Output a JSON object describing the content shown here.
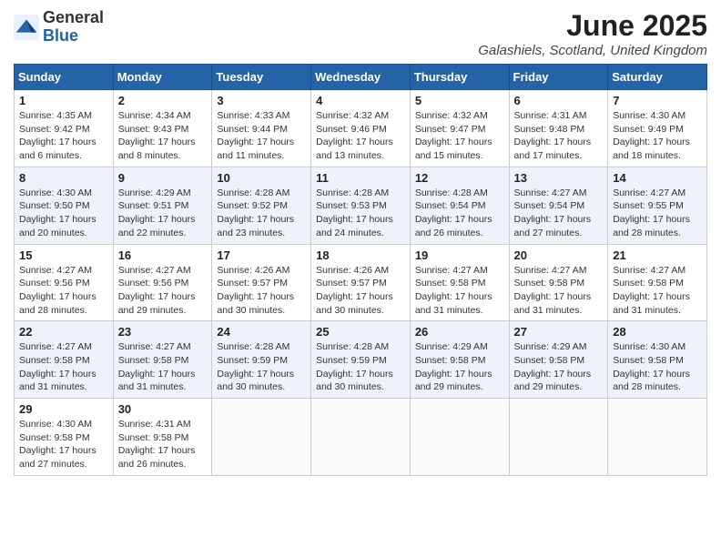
{
  "header": {
    "logo_general": "General",
    "logo_blue": "Blue",
    "month_title": "June 2025",
    "location": "Galashiels, Scotland, United Kingdom"
  },
  "days_of_week": [
    "Sunday",
    "Monday",
    "Tuesday",
    "Wednesday",
    "Thursday",
    "Friday",
    "Saturday"
  ],
  "weeks": [
    [
      {
        "day": "1",
        "sunrise": "4:35 AM",
        "sunset": "9:42 PM",
        "daylight": "17 hours and 6 minutes."
      },
      {
        "day": "2",
        "sunrise": "4:34 AM",
        "sunset": "9:43 PM",
        "daylight": "17 hours and 8 minutes."
      },
      {
        "day": "3",
        "sunrise": "4:33 AM",
        "sunset": "9:44 PM",
        "daylight": "17 hours and 11 minutes."
      },
      {
        "day": "4",
        "sunrise": "4:32 AM",
        "sunset": "9:46 PM",
        "daylight": "17 hours and 13 minutes."
      },
      {
        "day": "5",
        "sunrise": "4:32 AM",
        "sunset": "9:47 PM",
        "daylight": "17 hours and 15 minutes."
      },
      {
        "day": "6",
        "sunrise": "4:31 AM",
        "sunset": "9:48 PM",
        "daylight": "17 hours and 17 minutes."
      },
      {
        "day": "7",
        "sunrise": "4:30 AM",
        "sunset": "9:49 PM",
        "daylight": "17 hours and 18 minutes."
      }
    ],
    [
      {
        "day": "8",
        "sunrise": "4:30 AM",
        "sunset": "9:50 PM",
        "daylight": "17 hours and 20 minutes."
      },
      {
        "day": "9",
        "sunrise": "4:29 AM",
        "sunset": "9:51 PM",
        "daylight": "17 hours and 22 minutes."
      },
      {
        "day": "10",
        "sunrise": "4:28 AM",
        "sunset": "9:52 PM",
        "daylight": "17 hours and 23 minutes."
      },
      {
        "day": "11",
        "sunrise": "4:28 AM",
        "sunset": "9:53 PM",
        "daylight": "17 hours and 24 minutes."
      },
      {
        "day": "12",
        "sunrise": "4:28 AM",
        "sunset": "9:54 PM",
        "daylight": "17 hours and 26 minutes."
      },
      {
        "day": "13",
        "sunrise": "4:27 AM",
        "sunset": "9:54 PM",
        "daylight": "17 hours and 27 minutes."
      },
      {
        "day": "14",
        "sunrise": "4:27 AM",
        "sunset": "9:55 PM",
        "daylight": "17 hours and 28 minutes."
      }
    ],
    [
      {
        "day": "15",
        "sunrise": "4:27 AM",
        "sunset": "9:56 PM",
        "daylight": "17 hours and 28 minutes."
      },
      {
        "day": "16",
        "sunrise": "4:27 AM",
        "sunset": "9:56 PM",
        "daylight": "17 hours and 29 minutes."
      },
      {
        "day": "17",
        "sunrise": "4:26 AM",
        "sunset": "9:57 PM",
        "daylight": "17 hours and 30 minutes."
      },
      {
        "day": "18",
        "sunrise": "4:26 AM",
        "sunset": "9:57 PM",
        "daylight": "17 hours and 30 minutes."
      },
      {
        "day": "19",
        "sunrise": "4:27 AM",
        "sunset": "9:58 PM",
        "daylight": "17 hours and 31 minutes."
      },
      {
        "day": "20",
        "sunrise": "4:27 AM",
        "sunset": "9:58 PM",
        "daylight": "17 hours and 31 minutes."
      },
      {
        "day": "21",
        "sunrise": "4:27 AM",
        "sunset": "9:58 PM",
        "daylight": "17 hours and 31 minutes."
      }
    ],
    [
      {
        "day": "22",
        "sunrise": "4:27 AM",
        "sunset": "9:58 PM",
        "daylight": "17 hours and 31 minutes."
      },
      {
        "day": "23",
        "sunrise": "4:27 AM",
        "sunset": "9:58 PM",
        "daylight": "17 hours and 31 minutes."
      },
      {
        "day": "24",
        "sunrise": "4:28 AM",
        "sunset": "9:59 PM",
        "daylight": "17 hours and 30 minutes."
      },
      {
        "day": "25",
        "sunrise": "4:28 AM",
        "sunset": "9:59 PM",
        "daylight": "17 hours and 30 minutes."
      },
      {
        "day": "26",
        "sunrise": "4:29 AM",
        "sunset": "9:58 PM",
        "daylight": "17 hours and 29 minutes."
      },
      {
        "day": "27",
        "sunrise": "4:29 AM",
        "sunset": "9:58 PM",
        "daylight": "17 hours and 29 minutes."
      },
      {
        "day": "28",
        "sunrise": "4:30 AM",
        "sunset": "9:58 PM",
        "daylight": "17 hours and 28 minutes."
      }
    ],
    [
      {
        "day": "29",
        "sunrise": "4:30 AM",
        "sunset": "9:58 PM",
        "daylight": "17 hours and 27 minutes."
      },
      {
        "day": "30",
        "sunrise": "4:31 AM",
        "sunset": "9:58 PM",
        "daylight": "17 hours and 26 minutes."
      },
      null,
      null,
      null,
      null,
      null
    ]
  ],
  "labels": {
    "sunrise": "Sunrise:",
    "sunset": "Sunset:",
    "daylight": "Daylight:"
  }
}
